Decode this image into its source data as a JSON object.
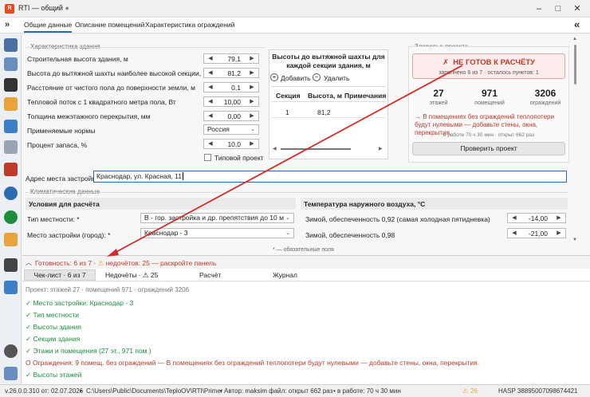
{
  "window": {
    "title": "RTI — общий",
    "unsaved_dot": "●"
  },
  "tabs": [
    "Общие данные",
    "Описание помещений",
    "Характеристика ограждений"
  ],
  "building": {
    "group_title": "Характеристика здания",
    "fields": [
      {
        "label": "Строительная высота здания, м",
        "value": "79,1"
      },
      {
        "label": "Высота до вытяжной шахты наиболее высокой секции, м",
        "value": "81,2"
      },
      {
        "label": "Расстояние от чистого пола до поверхности земли, м",
        "value": "0,1"
      },
      {
        "label": "Тепловой поток с 1 квадратного метра пола, Вт",
        "value": "10,00"
      },
      {
        "label": "Толщина межэтажного перекрытия, мм",
        "value": "0,00"
      }
    ],
    "norms_label": "Применяемые нормы",
    "norms_value": "Россия",
    "reserve_label": "Процент запаса, %",
    "reserve_value": "10,0",
    "typical_label": "Типовой проект",
    "address_label": "Адрес места застройки:",
    "address_value": "Краснодар, ул. Красная, 11"
  },
  "shaft": {
    "title": "Высоты до вытяжной шахты для каждой секции здания, м",
    "add_label": "Добавить",
    "delete_label": "Удалить",
    "headers": [
      "Секция",
      "Высота, м",
      "Примечания"
    ],
    "rows": [
      [
        "1",
        "81,2",
        ""
      ]
    ]
  },
  "health": {
    "title": "Здоровье проекта",
    "status": "НЕ ГОТОВ К РАСЧЁТУ",
    "status_icon": "✗",
    "sub": "заполнено 6 из 7 · осталось пунктов: 1",
    "stats": [
      {
        "num": "27",
        "label": "этажей"
      },
      {
        "num": "971",
        "label": "помещений"
      },
      {
        "num": "3206",
        "label": "ограждений"
      }
    ],
    "warning": "→ В помещениях без ограждений теплопотери будут нулевыми — добавьте стены, окна, перекрытия.",
    "meta": "в работе 70 ч 30 мин · открыт 662 раз",
    "check_label": "Проверить проект"
  },
  "climate": {
    "group_title": "Климатические данные",
    "left_header": "Условия для расчёта",
    "terrain_label": "Тип местности: *",
    "terrain_value": "В - гор. застройка и др. препятствия  до 10 м",
    "place_label": "Место застройки (город): *",
    "place_value": "Краснодар - 3",
    "right_header": "Температура наружного воздуха, °С",
    "temps": [
      {
        "label": "Зимой, обеспеченность 0,92 (самая холодная пятидневка)",
        "value": "-14,00"
      },
      {
        "label": "Зимой, обеспеченность 0,98",
        "value": "-21,00"
      }
    ],
    "required_note": "* — обязательные поля"
  },
  "readiness": {
    "summary_ready": "Готовность: 6 из 7",
    "summary_warn": "недочётов: 25 — раскройте панель",
    "bottom_tabs": [
      "Чек-лист · 6 из 7",
      "Недочёты · ⚠ 25",
      "Расчёт",
      "Журнал"
    ],
    "project_line": "Проект: этажей 27 · помещений 971 · ограждений 3206",
    "items": [
      {
        "text": "✓ Место застройки: Краснодар - 3",
        "ok": true
      },
      {
        "text": "✓ Тип местности",
        "ok": true
      },
      {
        "text": "✓ Высоты здания",
        "ok": true
      },
      {
        "text": "✓ Секции здания",
        "ok": true
      },
      {
        "text": "✓ Этажи и помещения (27 эт., 971 пом.)",
        "ok": true
      },
      {
        "text": "О  Ограждения: 9 помещ. без ограждений  —  В помещениях без ограждений теплопотери будут нулевыми — добавьте стены, окна, перекрытия.",
        "ok": false
      },
      {
        "text": "✓ Высоты этажей",
        "ok": true
      }
    ]
  },
  "status": {
    "version": "v.26.0.0.310 от: 02.07.2026",
    "path": "C:\\Users\\Public\\Documents\\TeploOV\\RTI\\Primer",
    "author": "• Автор: maksim файл: открыт 662 раз",
    "work": "• в работе: 70 ч 30 мин",
    "warn_count": "26",
    "hasp": "HASP 388950070986744​21"
  },
  "colors": {
    "accent": "#2b6cb0",
    "danger": "#c0392b",
    "ok": "#1e8e3e",
    "arrow": "#d62b2b"
  }
}
